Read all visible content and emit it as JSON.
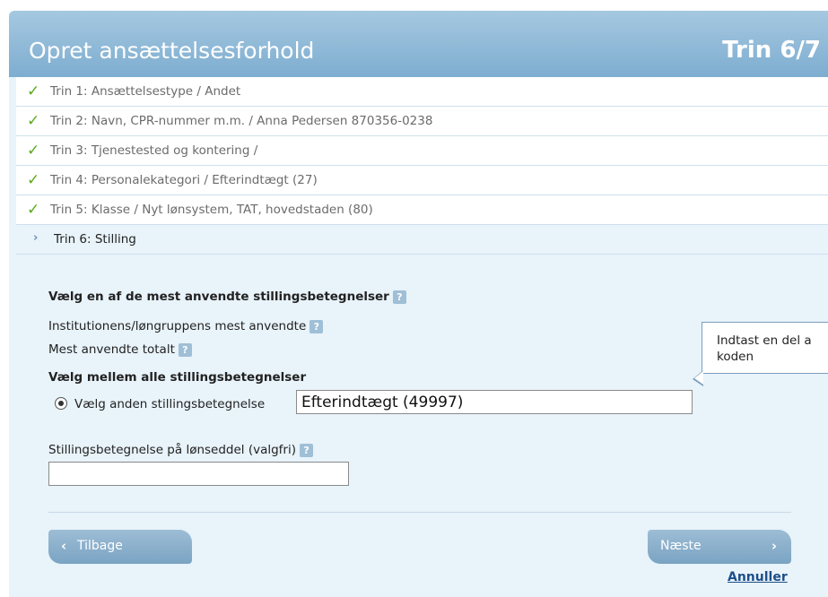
{
  "header": {
    "title": "Opret ansættelsesforhold",
    "step_indicator": "Trin 6/7"
  },
  "steps": [
    {
      "label": "Trin 1: Ansættelsestype / Andet",
      "done": true
    },
    {
      "label": "Trin 2: Navn, CPR-nummer m.m. / Anna Pedersen 870356-0238",
      "done": true
    },
    {
      "label": "Trin 3: Tjenestested og kontering /",
      "done": true
    },
    {
      "label": "Trin 4: Personalekategori / Efterindtægt (27)",
      "done": true
    },
    {
      "label": "Trin 5: Klasse / Nyt lønsystem, TAT, hovedstaden (80)",
      "done": true
    },
    {
      "label": "Trin 6: Stilling",
      "done": false
    }
  ],
  "icons": {
    "check": "✓",
    "arrow": "›",
    "help": "?",
    "chev_left": "‹",
    "chev_right": "›"
  },
  "form": {
    "most_used_title": "Vælg en af de mest anvendte stillingsbetegnelser",
    "institution_most_used": "Institutionens/løngruppens mest anvendte",
    "most_used_total": "Mest anvendte totalt",
    "all_title": "Vælg mellem alle stillingsbetegnelser",
    "other_radio_label": "Vælg anden stillingsbetegnelse",
    "other_input_value": "Efterindtægt (49997)",
    "payslip_label": "Stillingsbetegnelse på lønseddel (valgfri)",
    "payslip_value": ""
  },
  "tooltip": {
    "line1": "Indtast en del a",
    "line2": "koden"
  },
  "buttons": {
    "back": "Tilbage",
    "next": "Næste",
    "cancel": "Annuller"
  },
  "colors": {
    "accent": "#7eadd0",
    "check": "#5aaa1e",
    "link": "#1d4f8a"
  }
}
